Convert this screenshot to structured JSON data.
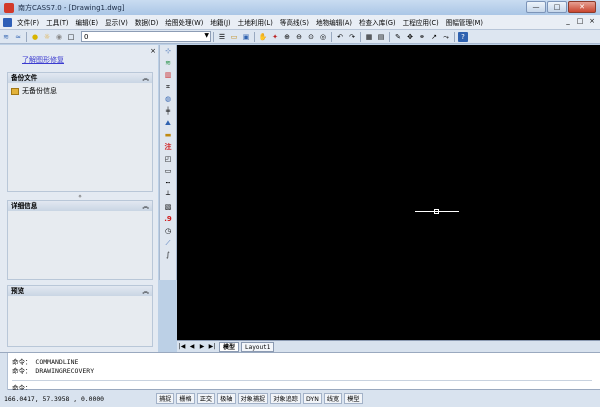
{
  "window": {
    "title": "南方CASS7.0 - [Drawing1.dwg]",
    "buttons": {
      "minimize": "—",
      "maximize": "□",
      "close": "✕"
    }
  },
  "menu": {
    "items": [
      "文件(F)",
      "工具(T)",
      "编辑(E)",
      "显示(V)",
      "数据(D)",
      "绘图处理(W)",
      "地籍(J)",
      "土地利用(L)",
      "等高线(S)",
      "地物编辑(A)",
      "检查入库(G)",
      "工程应用(C)",
      "图幅管理(M)"
    ],
    "right_controls": [
      "_",
      "□",
      "×"
    ]
  },
  "toolbar": {
    "layer_value": "0",
    "left_icons": [
      "layer-manager-icon",
      "layer-states-icon",
      "bulb-icon",
      "sun-icon",
      "lock-icon",
      "color-icon"
    ],
    "right_icons": [
      "list-icon",
      "open-icon",
      "save-icon",
      "pan-icon",
      "zoom-realtime-icon",
      "zoom-window-icon",
      "zoom-previous-icon",
      "zoom-all-icon",
      "undo-icon",
      "redo-icon",
      "calculator-icon",
      "properties-icon",
      "pencil-icon",
      "move-icon",
      "snap-icon",
      "line-icon",
      "help-icon"
    ]
  },
  "left_panel": {
    "close_glyph": "×",
    "repair_link": "了解图形修复",
    "backup_title": "备份文件",
    "backup_empty": "无备份信息",
    "details_title": "详细信息",
    "preview_title": "预览",
    "chevron": "︽"
  },
  "vertical_toolbar": {
    "icons": [
      "point-icon",
      "road-icon",
      "building-icon",
      "boundary-icon",
      "water-icon",
      "pipeline-icon",
      "terrain-icon",
      "annotation-text-icon",
      "rect-icon",
      "rect-outline-icon",
      "dashed-line-icon",
      "fence-icon",
      "hatch-icon",
      "elevation-point-icon",
      "clock-icon",
      "slash-line-icon",
      "curve-icon"
    ],
    "annotation_label": "注",
    "elevation_label": ".9"
  },
  "tabs": {
    "nav": [
      "|◀",
      "◀",
      "▶",
      "▶|"
    ],
    "items": [
      "模型",
      "Layout1"
    ]
  },
  "command": {
    "line1_prompt": "命令：",
    "line1_value": "COMMANDLINE",
    "line2_prompt": "命令：",
    "line2_value": "DRAWINGRECOVERY",
    "input_prompt": "命令："
  },
  "status": {
    "coords": "166.0417, 57.3958 , 0.0000",
    "modes": [
      "捕捉",
      "栅格",
      "正交",
      "极轴",
      "对象捕捉",
      "对象追踪",
      "DYN",
      "线宽",
      "模型"
    ]
  },
  "colors": {
    "canvas": "#000000",
    "crosshair": "#ffffff",
    "link": "#3b3bd0",
    "annotation_red": "#d11b1b"
  }
}
